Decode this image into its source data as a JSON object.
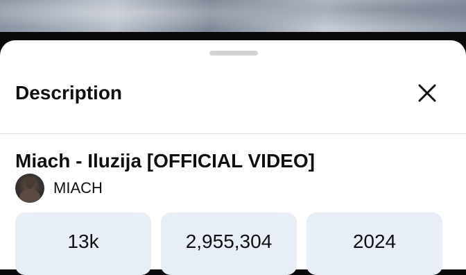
{
  "sheet": {
    "title": "Description"
  },
  "video": {
    "title": "Miach - Iluzija [OFFICIAL VIDEO]",
    "channel": "MIACH"
  },
  "stats": [
    {
      "value": "13k"
    },
    {
      "value": "2,955,304"
    },
    {
      "value": "2024"
    }
  ],
  "icons": {
    "close": "close-icon",
    "avatar": "channel-avatar"
  },
  "colors": {
    "sheet_bg": "#ffffff",
    "stat_card_bg": "#e8eef6",
    "text": "#0f0f0f"
  }
}
